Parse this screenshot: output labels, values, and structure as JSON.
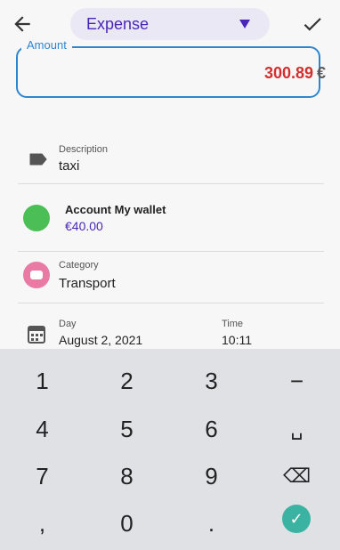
{
  "header": {
    "type_value": "Expense"
  },
  "amount": {
    "label": "Amount",
    "value": "300.89",
    "currency": "€"
  },
  "description": {
    "label": "Description",
    "value": "taxi"
  },
  "account": {
    "name": "Account My wallet",
    "balance": "€40.00",
    "color": "#4bbf55"
  },
  "category": {
    "label": "Category",
    "value": "Transport",
    "color": "#e87aa3"
  },
  "date": {
    "day_label": "Day",
    "day_value": "August 2, 2021",
    "time_label": "Time",
    "time_value": "10:11"
  },
  "keyboard": {
    "keys": [
      "1",
      "2",
      "3",
      "−",
      "4",
      "5",
      "6",
      "␣",
      "7",
      "8",
      "9",
      "⌫",
      ",",
      "0",
      ".",
      "✓"
    ]
  },
  "colors": {
    "accent": "#4a26b8",
    "amount": "#d32f2f",
    "field_border": "#2e86d1",
    "ok_key": "#3bb3a3"
  }
}
